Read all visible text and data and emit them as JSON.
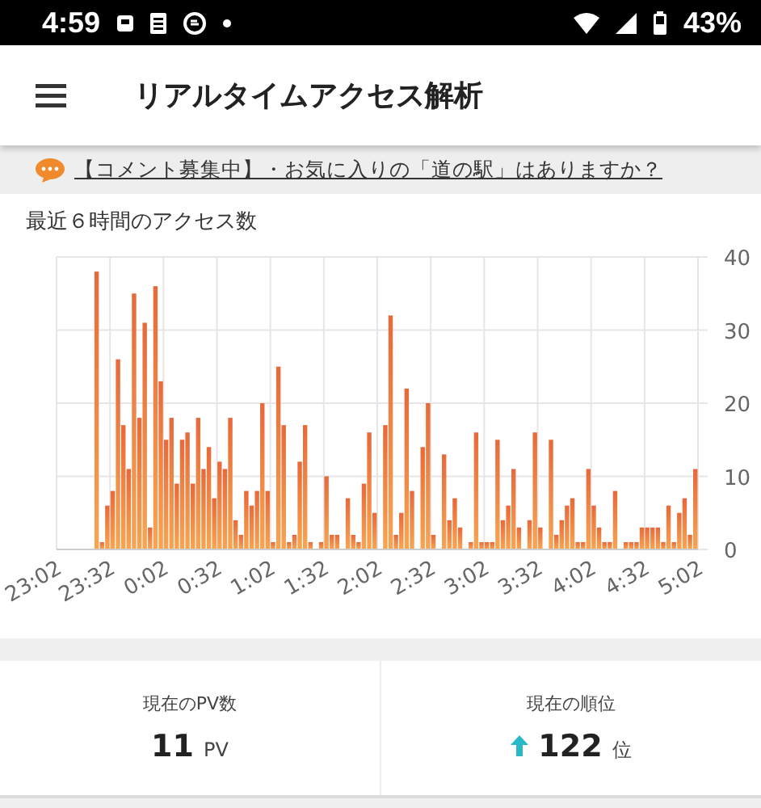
{
  "status_bar": {
    "time": "4:59",
    "battery": "43%"
  },
  "app_bar": {
    "title": "リアルタイムアクセス解析"
  },
  "banner": {
    "text": "【コメント募集中】・お気に入りの「道の駅」はありますか？"
  },
  "access_chart": {
    "chart_data": {
      "type": "bar",
      "title": "最近６時間のアクセス数",
      "grid": true,
      "ylim": [
        0,
        40
      ],
      "yticks": [
        0,
        10,
        20,
        30,
        40
      ],
      "categories": [
        "23:02",
        null,
        null,
        null,
        null,
        null,
        null,
        null,
        null,
        null,
        "23:32",
        null,
        null,
        null,
        null,
        null,
        null,
        null,
        null,
        null,
        "0:02",
        null,
        null,
        null,
        null,
        null,
        null,
        null,
        null,
        null,
        "0:32",
        null,
        null,
        null,
        null,
        null,
        null,
        null,
        null,
        null,
        "1:02",
        null,
        null,
        null,
        null,
        null,
        null,
        null,
        null,
        null,
        "1:32",
        null,
        null,
        null,
        null,
        null,
        null,
        null,
        null,
        null,
        "2:02",
        null,
        null,
        null,
        null,
        null,
        null,
        null,
        null,
        null,
        "2:32",
        null,
        null,
        null,
        null,
        null,
        null,
        null,
        null,
        null,
        "3:02",
        null,
        null,
        null,
        null,
        null,
        null,
        null,
        null,
        null,
        "3:32",
        null,
        null,
        null,
        null,
        null,
        null,
        null,
        null,
        null,
        "4:02",
        null,
        null,
        null,
        null,
        null,
        null,
        null,
        null,
        null,
        "4:32",
        null,
        null,
        null,
        null,
        null,
        null,
        null,
        null,
        null,
        "5:02"
      ],
      "values": [
        0,
        0,
        0,
        0,
        0,
        0,
        0,
        38,
        1,
        6,
        8,
        26,
        17,
        11,
        35,
        18,
        31,
        3,
        36,
        23,
        15,
        18,
        9,
        15,
        16,
        9,
        18,
        11,
        14,
        7,
        12,
        11,
        18,
        4,
        2,
        8,
        6,
        8,
        20,
        8,
        1,
        25,
        17,
        1,
        2,
        12,
        17,
        1,
        0,
        1,
        10,
        2,
        2,
        0,
        7,
        2,
        1,
        9,
        16,
        5,
        0,
        17,
        32,
        2,
        5,
        22,
        8,
        0,
        14,
        20,
        2,
        0,
        13,
        4,
        7,
        3,
        0,
        1,
        16,
        1,
        1,
        1,
        15,
        4,
        6,
        11,
        3,
        0,
        4,
        16,
        3,
        0,
        15,
        2,
        4,
        6,
        7,
        1,
        1,
        11,
        6,
        3,
        1,
        1,
        8,
        0,
        1,
        1,
        1,
        3,
        3,
        3,
        3,
        1,
        6,
        1,
        5,
        7,
        2,
        11,
        null
      ]
    }
  },
  "stats": [
    {
      "kind": "count",
      "label": "現在のPV数",
      "value": "11",
      "unit": "PV"
    },
    {
      "kind": "rank",
      "label": "現在の順位",
      "value": "122",
      "unit": "位"
    }
  ]
}
